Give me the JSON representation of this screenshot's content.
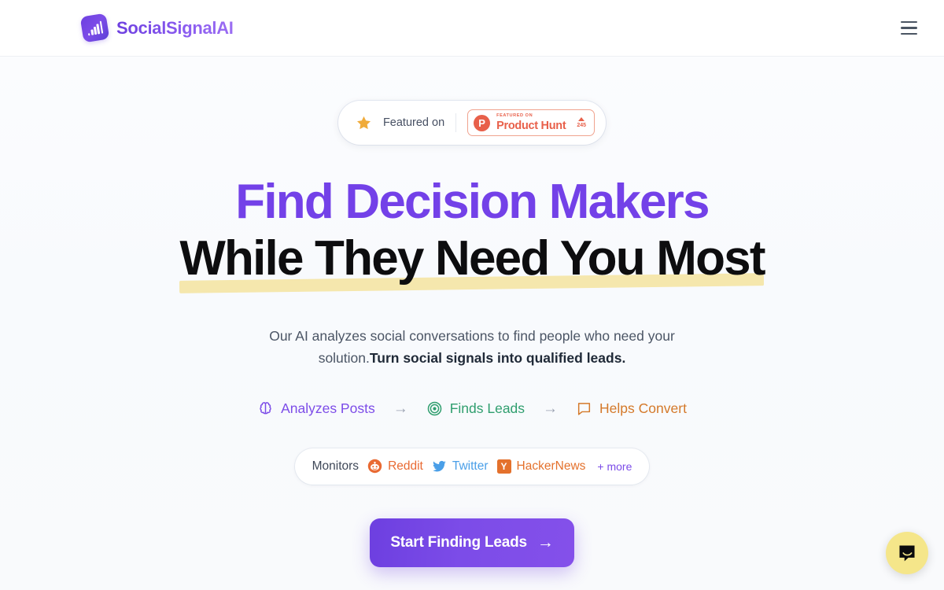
{
  "header": {
    "brand_name": "SocialSignalAI",
    "brand_icon": "bar-chart-logo-icon",
    "menu_icon": "hamburger-menu-icon"
  },
  "hero": {
    "featured_badge": {
      "star_icon": "star-icon",
      "label": "Featured on",
      "product_hunt": {
        "logo_letter": "P",
        "kicker": "FEATURED ON",
        "name": "Product Hunt",
        "votes": "245",
        "caret_icon": "upvote-caret-icon"
      }
    },
    "headline_line1": "Find Decision Makers",
    "headline_line2": "While They Need You Most",
    "subtitle_plain": "Our AI analyzes social conversations to find people who need your solution.",
    "subtitle_bold": "Turn social signals into qualified leads.",
    "flow": [
      {
        "label": "Analyzes Posts",
        "icon": "brain-icon",
        "color": "#7c4ce8"
      },
      {
        "label": "Finds Leads",
        "icon": "target-icon",
        "color": "#2f9e6e"
      },
      {
        "label": "Helps Convert",
        "icon": "chat-bubble-icon",
        "color": "#d4792a"
      }
    ],
    "flow_arrow": "→",
    "monitors": {
      "label": "Monitors",
      "platforms": [
        {
          "label": "Reddit",
          "icon": "reddit-icon",
          "color": "#e96a33"
        },
        {
          "label": "Twitter",
          "icon": "twitter-bird-icon",
          "color": "#4a9fe8"
        },
        {
          "label": "HackerNews",
          "icon": "hackernews-icon",
          "color": "#e4712c",
          "glyph": "Y"
        }
      ],
      "more_label": "+ more"
    },
    "cta": {
      "label": "Start Finding Leads",
      "arrow": "→"
    }
  },
  "chat_widget": {
    "icon": "chat-bubble-smile-icon",
    "color": "#f5e68a"
  },
  "colors": {
    "brand_purple": "#7341e8",
    "accent_purple": "#7c4ce8",
    "highlight_yellow": "#f5e7ad",
    "product_hunt_red": "#e8604a",
    "page_background": "#f8fafd"
  }
}
